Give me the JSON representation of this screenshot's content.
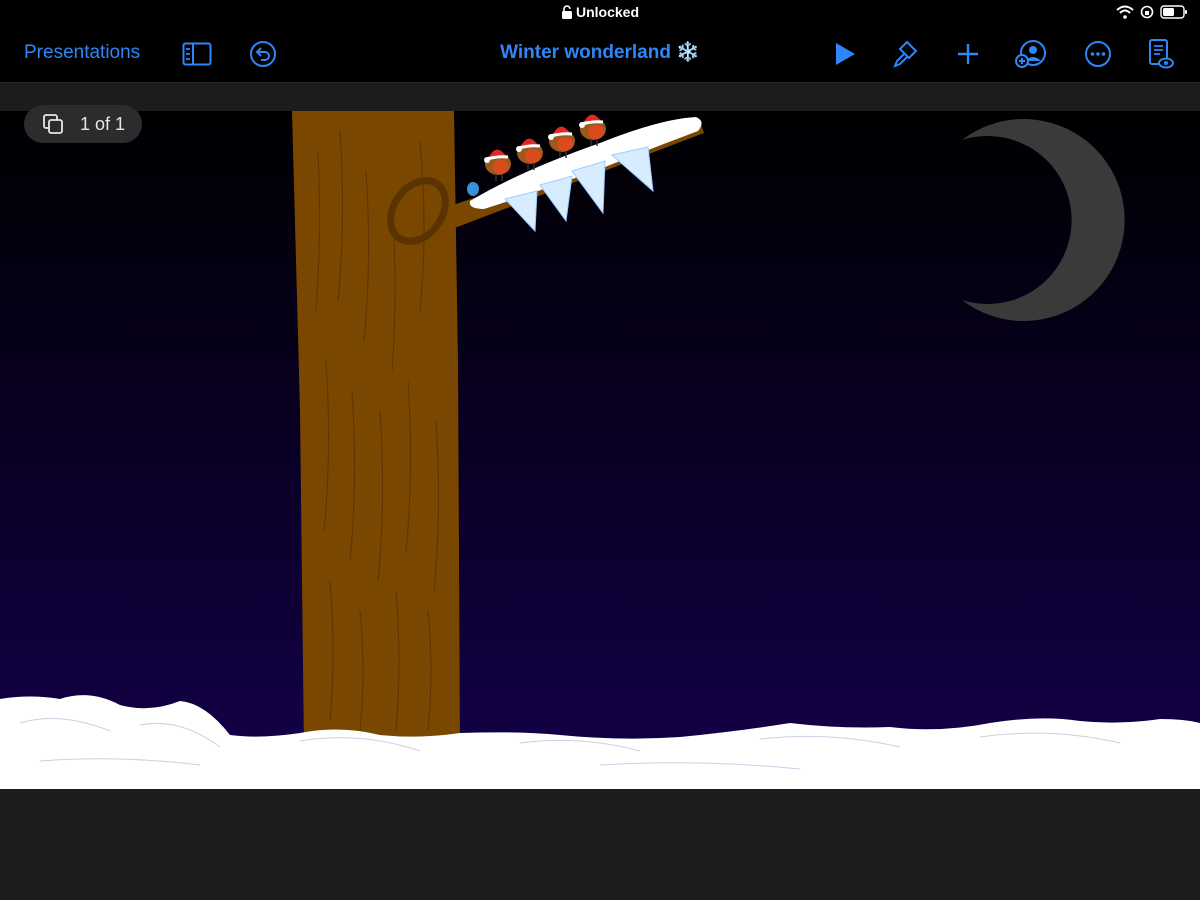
{
  "status_bar": {
    "lock_label": "Unlocked",
    "icons": [
      "lock-icon",
      "wifi-icon",
      "rotation-lock-icon",
      "battery-icon"
    ]
  },
  "toolbar": {
    "back_label": "Presentations",
    "title": "Winter wonderland ❄️",
    "accent_color": "#2f86f6",
    "icons": [
      "sidebar-icon",
      "undo-icon",
      "play-icon",
      "paintbrush-icon",
      "plus-icon",
      "collaborate-icon",
      "more-icon",
      "presenter-view-icon"
    ]
  },
  "slide_counter": {
    "label": "1 of 1",
    "icon": "slides-stack-icon"
  },
  "slide": {
    "sky_top_color": "#000000",
    "sky_bottom_color": "#14004a",
    "tree_color": "#7a4700",
    "moon_color": "#3a3a3a",
    "snow_color": "#ffffff",
    "robin_count": 4
  }
}
